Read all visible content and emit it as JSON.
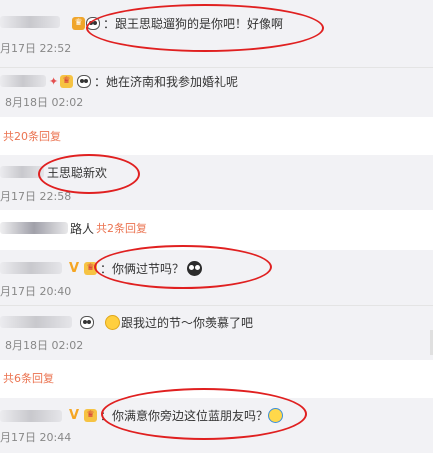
{
  "comments": [
    {
      "reply_prefix": "：",
      "text": "跟王思聪遛狗的是你吧！好像啊",
      "time": "月17日 22:52"
    },
    {
      "reply_prefix": "：",
      "text": "她在济南和我参加婚礼呢",
      "time": "8月18日 02:02"
    },
    {
      "more_label": "共20条回复"
    },
    {
      "text": "王思聪新欢",
      "time": "月17日 22:58"
    },
    {
      "name_tail": "路人",
      "more_label": "共2条回复"
    },
    {
      "reply_prefix": "：",
      "text": "你俩过节吗？",
      "time": "月17日 20:40"
    },
    {
      "text": "跟我过的节～你羡慕了吧",
      "time": "8月18日 02:02"
    },
    {
      "more_label": "共6条回复"
    },
    {
      "reply_prefix": "：",
      "text": "你满意你旁边这位蓝朋友吗？",
      "time": "月17日 20:44"
    }
  ],
  "icons": {
    "vip": "vip-badge-icon",
    "verified": "verified-v-icon",
    "panda": "panda-emoji-icon",
    "shy": "shy-emoji-icon",
    "dark": "black-face-emoji-icon",
    "laugh": "laugh-cry-emoji-icon"
  },
  "colors": {
    "link": "#eb7350",
    "annotation": "#e02020",
    "timestamp": "#888888"
  }
}
